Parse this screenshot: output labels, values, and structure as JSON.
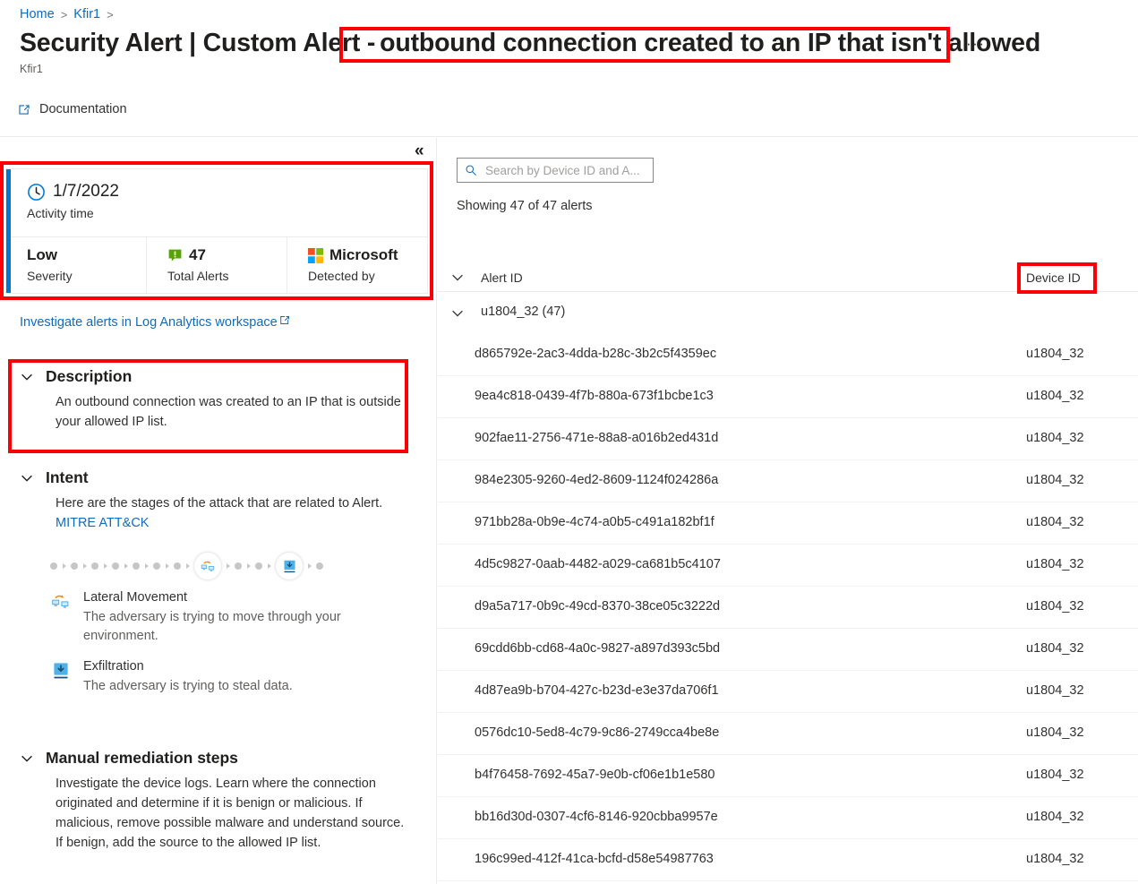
{
  "breadcrumb": {
    "items": [
      {
        "label": "Home"
      },
      {
        "label": "Kfir1"
      }
    ],
    "separator": ">"
  },
  "header": {
    "title_prefix": "Security Alert | Custom Alert -",
    "title_highlight": "outbound connection created to an IP that isn't allowed",
    "subtitle": "Kfir1",
    "more_menu": "···"
  },
  "commandbar": {
    "documentation_label": "Documentation",
    "documentation_icon": "external-link-icon"
  },
  "left_panel": {
    "collapse_icon": "«",
    "summary": {
      "activity_time_value": "1/7/2022",
      "activity_time_label": "Activity time",
      "activity_time_icon": "clock-icon",
      "severity_value": "Low",
      "severity_label": "Severity",
      "total_alerts_value": "47",
      "total_alerts_label": "Total Alerts",
      "total_alerts_icon": "alert-badge-icon",
      "detected_by_value": "Microsoft",
      "detected_by_label": "Detected by",
      "detected_by_icon": "microsoft-logo-icon",
      "accent_color": "#0078d4"
    },
    "investigate_link": "Investigate alerts in Log Analytics workspace",
    "investigate_link_icon": "external-link-icon",
    "description": {
      "title": "Description",
      "body": "An outbound connection was created to an IP that is outside your allowed IP list."
    },
    "intent": {
      "title": "Intent",
      "body_prefix": "Here are the stages of the attack that are related to Alert.",
      "mitre_link": "MITRE ATT&CK",
      "killchain": {
        "total_nodes": 14,
        "active_indices": [
          7,
          11
        ],
        "active_icons": [
          "lateral-movement-icon",
          "exfiltration-icon"
        ]
      },
      "stages": [
        {
          "name": "Lateral Movement",
          "description": "The adversary is trying to move through your environment.",
          "icon": "lateral-movement-icon"
        },
        {
          "name": "Exfiltration",
          "description": "The adversary is trying to steal data.",
          "icon": "exfiltration-icon"
        }
      ]
    },
    "remediation": {
      "title": "Manual remediation steps",
      "body": "Investigate the device logs. Learn where the connection originated and determine if it is benign or malicious. If malicious, remove possible malware and understand source. If benign, add the source to the allowed IP list."
    }
  },
  "right_panel": {
    "search": {
      "placeholder": "Search by Device ID and A...",
      "value": "",
      "icon": "search-icon"
    },
    "showing_text": "Showing 47 of 47 alerts",
    "columns": {
      "alert_id": "Alert ID",
      "device_id": "Device ID"
    },
    "group": {
      "label": "u1804_32 (47)"
    },
    "rows": [
      {
        "alert_id": "d865792e-2ac3-4dda-b28c-3b2c5f4359ec",
        "device_id": "u1804_32"
      },
      {
        "alert_id": "9ea4c818-0439-4f7b-880a-673f1bcbe1c3",
        "device_id": "u1804_32"
      },
      {
        "alert_id": "902fae11-2756-471e-88a8-a016b2ed431d",
        "device_id": "u1804_32"
      },
      {
        "alert_id": "984e2305-9260-4ed2-8609-1124f024286a",
        "device_id": "u1804_32"
      },
      {
        "alert_id": "971bb28a-0b9e-4c74-a0b5-c491a182bf1f",
        "device_id": "u1804_32"
      },
      {
        "alert_id": "4d5c9827-0aab-4482-a029-ca681b5c4107",
        "device_id": "u1804_32"
      },
      {
        "alert_id": "d9a5a717-0b9c-49cd-8370-38ce05c3222d",
        "device_id": "u1804_32"
      },
      {
        "alert_id": "69cdd6bb-cd68-4a0c-9827-a897d393c5bd",
        "device_id": "u1804_32"
      },
      {
        "alert_id": "4d87ea9b-b704-427c-b23d-e3e37da706f1",
        "device_id": "u1804_32"
      },
      {
        "alert_id": "0576dc10-5ed8-4c79-9c86-2749cca4be8e",
        "device_id": "u1804_32"
      },
      {
        "alert_id": "b4f76458-7692-45a7-9e0b-cf06e1b1e580",
        "device_id": "u1804_32"
      },
      {
        "alert_id": "bb16d30d-0307-4cf6-8146-920cbba9957e",
        "device_id": "u1804_32"
      },
      {
        "alert_id": "196c99ed-412f-41ca-bcfd-d58e54987763",
        "device_id": "u1804_32"
      }
    ]
  },
  "annotations": {
    "highlight_color": "#fb0007",
    "boxes": [
      "title-highlight",
      "summary-card",
      "description-section",
      "device-id-column"
    ]
  }
}
